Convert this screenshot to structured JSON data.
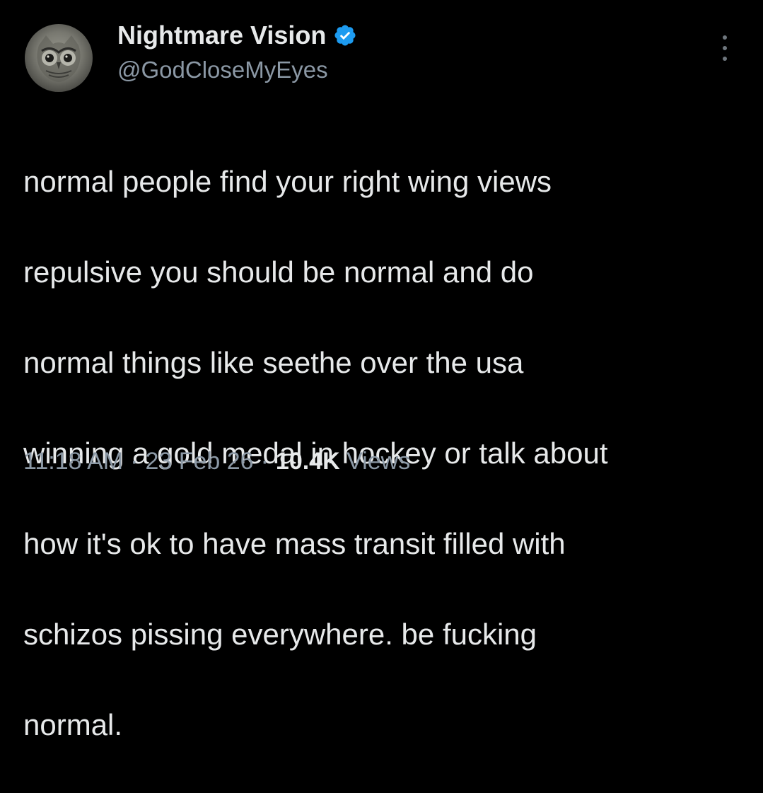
{
  "tweet": {
    "author": {
      "display_name": "Nightmare Vision",
      "handle": "@GodCloseMyEyes",
      "verified": true,
      "avatar_icon": "owl-avatar-icon"
    },
    "more_icon": "more-options-icon",
    "text_lines": [
      "normal people find your right wing views",
      "repulsive you should be normal and do",
      "normal things like seethe over the usa",
      "winning a gold medal in hockey or talk about",
      "how it's ok to have mass transit filled with",
      "schizos pissing everywhere. be fucking",
      "normal."
    ],
    "time": "11:18 AM",
    "date": "23 Feb 26",
    "separator": "·",
    "views_count": "10.4K",
    "views_label": "Views"
  },
  "colors": {
    "background": "#000000",
    "primary_text": "#e7e9ea",
    "secondary_text": "#8b98a5",
    "verified_badge": "#1d9bf0"
  }
}
